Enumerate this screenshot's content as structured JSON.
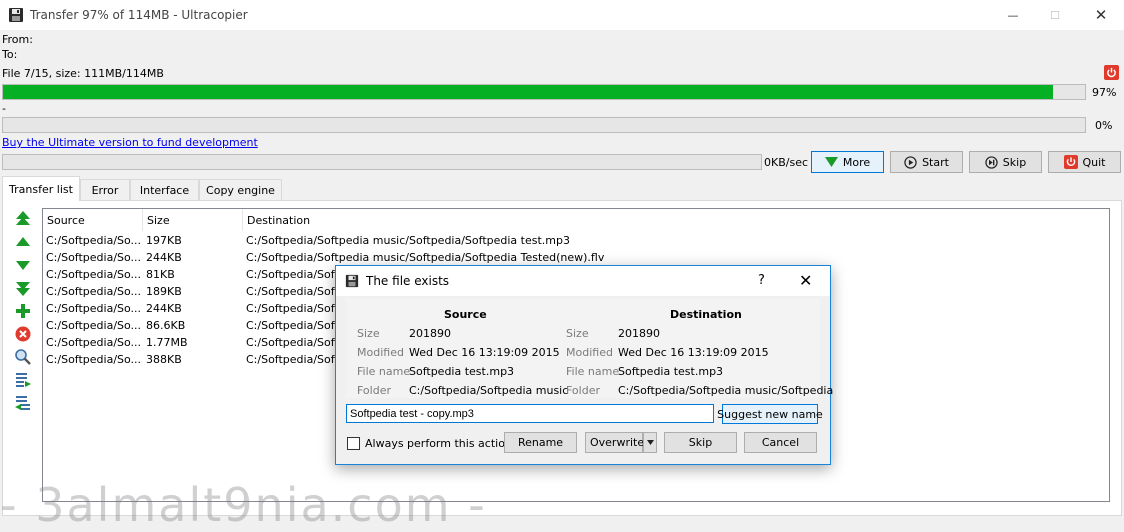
{
  "window": {
    "title": "Transfer 97% of 114MB - Ultracopier",
    "min_glyph": "—",
    "max_glyph": "☐",
    "close_glyph": "✕"
  },
  "info": {
    "from_label": "From:",
    "to_label": "To:",
    "file_info": "File 7/15, size: 111MB/114MB",
    "dash": "-"
  },
  "progress": {
    "file_fraction": 0.97,
    "file_percent": "97%",
    "total_fraction": 0.0,
    "total_percent": "0%",
    "speed_fraction": 0.0,
    "speed": "0KB/sec"
  },
  "links": {
    "buy": "Buy the Ultimate version to fund development"
  },
  "buttons": {
    "more": "More",
    "start": "Start",
    "skip": "Skip",
    "quit": "Quit"
  },
  "tabs": [
    "Transfer list",
    "Error",
    "Interface",
    "Copy engine"
  ],
  "list": {
    "headers": [
      "Source",
      "Size",
      "Destination"
    ],
    "rows": [
      {
        "source": "C:/Softpedia/So...",
        "size": "197KB",
        "destination": "C:/Softpedia/Softpedia music/Softpedia/Softpedia test.mp3"
      },
      {
        "source": "C:/Softpedia/So...",
        "size": "244KB",
        "destination": "C:/Softpedia/Softpedia music/Softpedia/Softpedia Tested(new).flv"
      },
      {
        "source": "C:/Softpedia/So...",
        "size": "81KB",
        "destination": "C:/Softpedia/Soft"
      },
      {
        "source": "C:/Softpedia/So...",
        "size": "189KB",
        "destination": "C:/Softpedia/Soft"
      },
      {
        "source": "C:/Softpedia/So...",
        "size": "244KB",
        "destination": "C:/Softpedia/Soft"
      },
      {
        "source": "C:/Softpedia/So...",
        "size": "86.6KB",
        "destination": "C:/Softpedia/Soft"
      },
      {
        "source": "C:/Softpedia/So...",
        "size": "1.77MB",
        "destination": "C:/Softpedia/Soft"
      },
      {
        "source": "C:/Softpedia/So...",
        "size": "388KB",
        "destination": "C:/Softpedia/Soft"
      }
    ]
  },
  "dialog": {
    "title": "The file exists",
    "help": "?",
    "close": "✕",
    "source_head": "Source",
    "dest_head": "Destination",
    "labels": {
      "size": "Size",
      "modified": "Modified",
      "file_name": "File name",
      "folder": "Folder"
    },
    "source": {
      "size": "201890",
      "modified": "Wed Dec 16 13:19:09 2015",
      "file_name": "Softpedia test.mp3",
      "folder": "C:/Softpedia/Softpedia music"
    },
    "destination": {
      "size": "201890",
      "modified": "Wed Dec 16 13:19:09 2015",
      "file_name": "Softpedia test.mp3",
      "folder": "C:/Softpedia/Softpedia music/Softpedia"
    },
    "new_name": "Softpedia test - copy.mp3",
    "suggest": "Suggest new name",
    "always": "Always perform this action",
    "rename": "Rename",
    "overwrite": "Overwrite",
    "skip": "Skip",
    "cancel": "Cancel"
  },
  "watermark": "- 3almalt9nia.com -",
  "colors": {
    "progress": "#06b025",
    "accent": "#0078d7",
    "quit_red": "#e03a2c",
    "arrow_green": "#1a9a28"
  }
}
